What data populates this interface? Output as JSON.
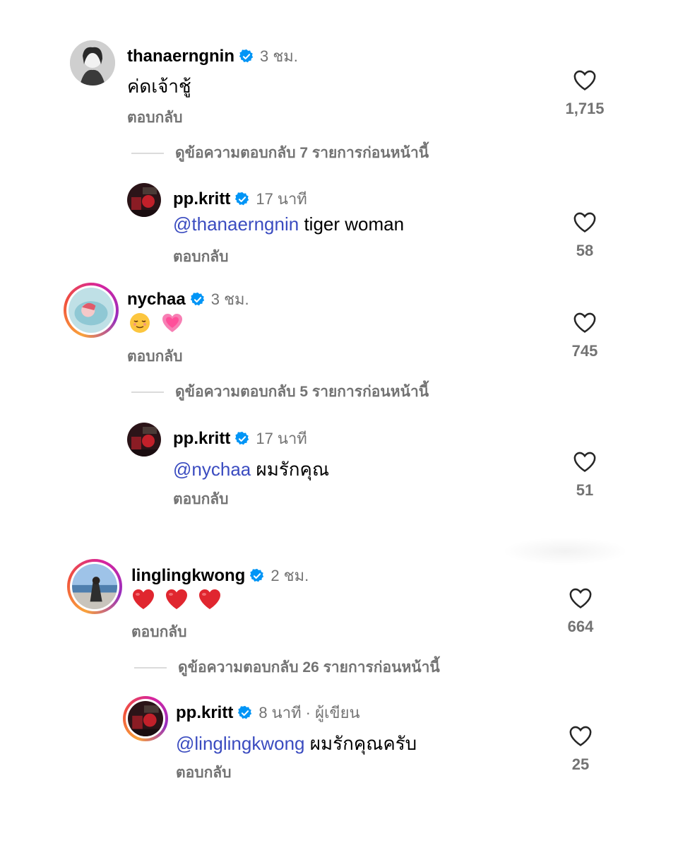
{
  "comments": [
    {
      "username": "thanaerngnin",
      "time": "3 ชม.",
      "text": "ค่ดเจ้าชู้",
      "reply_label": "ตอบกลับ",
      "likes": "1,715",
      "view_replies": "ดูข้อความตอบกลับ 7 รายการก่อนหน้านี้",
      "reply": {
        "username": "pp.kritt",
        "time": "17 นาที",
        "mention": "@thanaerngnin",
        "text": "tiger woman",
        "reply_label": "ตอบกลับ",
        "likes": "58"
      }
    },
    {
      "username": "nychaa",
      "time": "3 ชม.",
      "text_icons": [
        "relieved-face-emoji",
        "growing-heart-emoji"
      ],
      "reply_label": "ตอบกลับ",
      "likes": "745",
      "view_replies": "ดูข้อความตอบกลับ 5 รายการก่อนหน้านี้",
      "reply": {
        "username": "pp.kritt",
        "time": "17 นาที",
        "mention": "@nychaa",
        "text": "ผมรักคุณ",
        "reply_label": "ตอบกลับ",
        "likes": "51"
      }
    },
    {
      "username": "linglingkwong",
      "time": "2 ชม.",
      "text_icons": [
        "red-heart-emoji",
        "red-heart-emoji",
        "red-heart-emoji"
      ],
      "reply_label": "ตอบกลับ",
      "likes": "664",
      "view_replies": "ดูข้อความตอบกลับ 26 รายการก่อนหน้านี้",
      "reply": {
        "username": "pp.kritt",
        "time": "8 นาที · ผู้เขียน",
        "mention": "@linglingkwong",
        "text": "ผมรักคุณครับ",
        "reply_label": "ตอบกลับ",
        "likes": "25"
      }
    }
  ],
  "colors": {
    "verified": "#0095f6",
    "mention": "#3b4cc0",
    "secondary_text": "#737373",
    "story_ring": [
      "#f9a23b",
      "#d6249f",
      "#962fbf"
    ]
  }
}
